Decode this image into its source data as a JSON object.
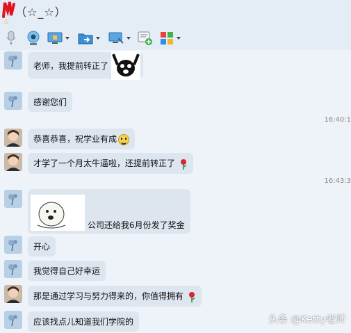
{
  "header": {
    "contact_name_suffix": "（☆_☆）",
    "star": "☆"
  },
  "toolbar": {
    "buttons": [
      {
        "icon": "microphone-icon"
      },
      {
        "icon": "webcam-icon"
      },
      {
        "icon": "screen-share-icon"
      },
      {
        "icon": "folder-transfer-icon"
      },
      {
        "icon": "remote-desktop-icon"
      },
      {
        "icon": "create-group-icon"
      },
      {
        "icon": "apps-icon"
      }
    ]
  },
  "messages": [
    {
      "text": "老师，我提前转正了",
      "sticker": "cheering-face"
    },
    {
      "text": "感谢您们"
    },
    {
      "timestamp": "16:40:1"
    },
    {
      "text": "恭喜恭喜，祝学业有成",
      "emoji": "smiley"
    },
    {
      "text": "才学了一个月太牛逼啦，还提前转正了",
      "emoji": "rose"
    },
    {
      "timestamp": "16:43:3"
    },
    {
      "text": "公司还给我6月份发了奖金",
      "sticker": "bun-face"
    },
    {
      "text": "开心"
    },
    {
      "text": "我觉得自己好幸运"
    },
    {
      "text": "那是通过学习与努力得来的，你值得拥有",
      "emoji": "rose"
    },
    {
      "text": "应该找点儿知道我们学院的"
    }
  ],
  "watermark": "头条 @Ketty老师",
  "colors": {
    "bubble": "#dde5ef",
    "background": "#eef3f9",
    "toolbar": "#e4ecf6"
  }
}
